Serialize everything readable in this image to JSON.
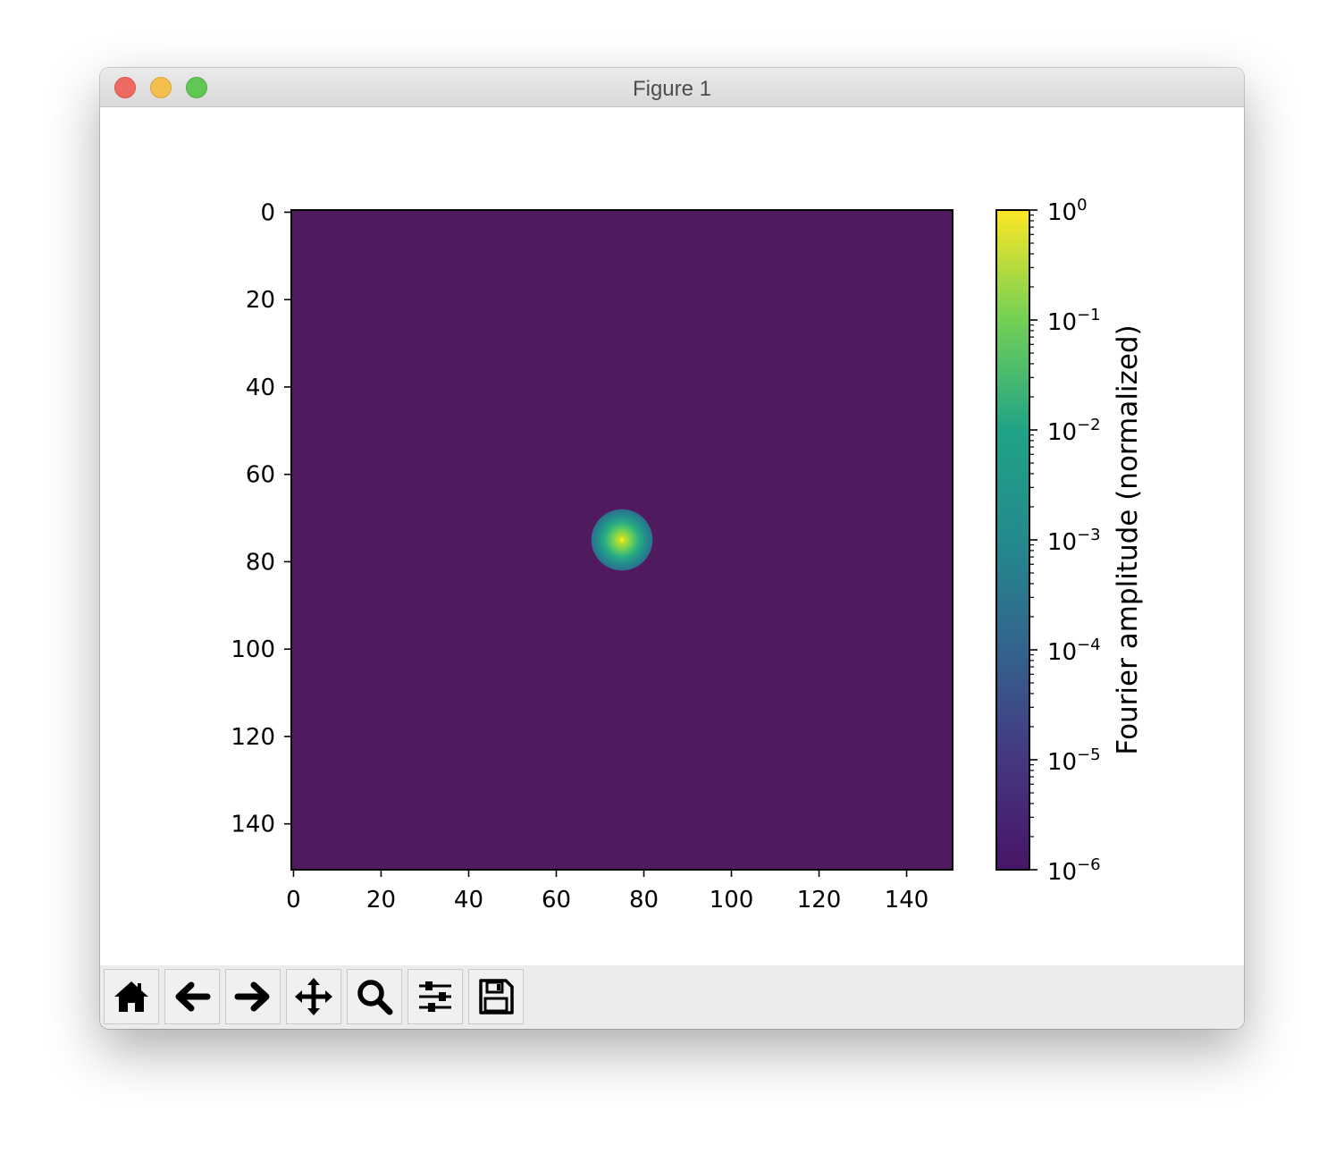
{
  "window": {
    "title": "Figure 1"
  },
  "toolbar": {
    "buttons": [
      {
        "name": "home-button",
        "icon": "home-icon"
      },
      {
        "name": "back-button",
        "icon": "arrow-left-icon"
      },
      {
        "name": "forward-button",
        "icon": "arrow-right-icon"
      },
      {
        "name": "pan-button",
        "icon": "move-icon"
      },
      {
        "name": "zoom-button",
        "icon": "magnifier-icon"
      },
      {
        "name": "configure-subplots-button",
        "icon": "sliders-icon"
      },
      {
        "name": "save-button",
        "icon": "floppy-disk-icon"
      }
    ]
  },
  "chart_data": {
    "type": "heatmap",
    "title": "",
    "xlabel": "",
    "ylabel": "",
    "xlim": [
      -0.5,
      150.5
    ],
    "ylim": [
      150.5,
      -0.5
    ],
    "x_ticks": [
      0,
      20,
      40,
      60,
      80,
      100,
      120,
      140
    ],
    "y_ticks": [
      0,
      20,
      40,
      60,
      80,
      100,
      120,
      140
    ],
    "peak": {
      "x": 75,
      "y": 75,
      "value": 1.0
    },
    "background_value": 1e-06,
    "blob_radius": 7,
    "colormap": "viridis",
    "colorbar": {
      "label": "Fourier amplitude (normalized)",
      "scale": "log",
      "range": [
        1e-06,
        1
      ],
      "ticks": [
        {
          "value": 1,
          "label": "10",
          "exp": "0"
        },
        {
          "value": 0.1,
          "label": "10",
          "exp": "−1"
        },
        {
          "value": 0.01,
          "label": "10",
          "exp": "−2"
        },
        {
          "value": 0.001,
          "label": "10",
          "exp": "−3"
        },
        {
          "value": 0.0001,
          "label": "10",
          "exp": "−4"
        },
        {
          "value": 1e-05,
          "label": "10",
          "exp": "−5"
        },
        {
          "value": 1e-06,
          "label": "10",
          "exp": "−6"
        }
      ]
    },
    "grid": false
  }
}
